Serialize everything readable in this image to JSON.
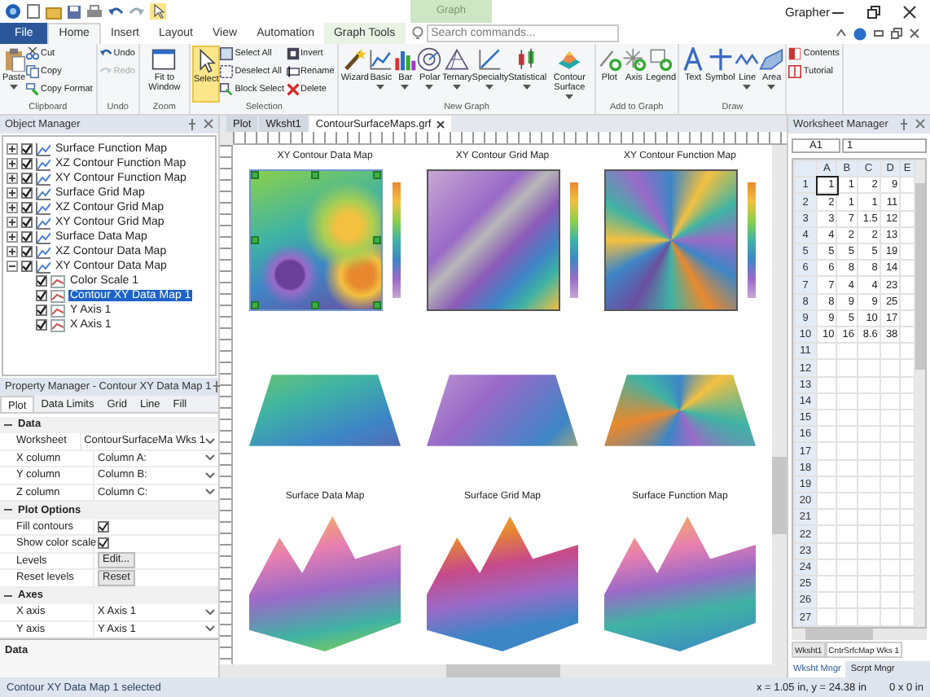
{
  "window": {
    "title": "Grapher",
    "contextual_header": "Graph"
  },
  "ribbon_tabs": [
    {
      "label": "File",
      "kind": "file",
      "selected": false
    },
    {
      "label": "Home",
      "kind": "tab",
      "selected": true
    },
    {
      "label": "Insert",
      "kind": "tab",
      "selected": false
    },
    {
      "label": "Layout",
      "kind": "tab",
      "selected": false
    },
    {
      "label": "View",
      "kind": "tab",
      "selected": false
    },
    {
      "label": "Automation",
      "kind": "tab",
      "selected": false
    },
    {
      "label": "Graph Tools",
      "kind": "contextual",
      "selected": false
    }
  ],
  "search": {
    "placeholder": "Search commands..."
  },
  "ribbon_groups": [
    {
      "label": "Clipboard",
      "buttons": [
        {
          "label": "Paste",
          "kind": "large",
          "dropdown": true,
          "disabled": false,
          "on": false
        },
        {
          "label": "Cut",
          "kind": "small",
          "dropdown": false,
          "disabled": false,
          "on": false
        },
        {
          "label": "Copy",
          "kind": "small",
          "dropdown": false,
          "disabled": false,
          "on": false
        },
        {
          "label": "Copy Format",
          "kind": "small",
          "dropdown": false,
          "disabled": false,
          "on": false
        }
      ]
    },
    {
      "label": "Undo",
      "buttons": [
        {
          "label": "Undo",
          "kind": "small",
          "dropdown": false,
          "disabled": false,
          "on": false
        },
        {
          "label": "Redo",
          "kind": "small",
          "dropdown": false,
          "disabled": true,
          "on": false
        }
      ]
    },
    {
      "label": "Zoom",
      "buttons": [
        {
          "label": "Fit to Window",
          "kind": "large",
          "dropdown": false,
          "disabled": false,
          "on": false
        }
      ]
    },
    {
      "label": "Selection",
      "buttons": [
        {
          "label": "Select",
          "kind": "large",
          "dropdown": false,
          "disabled": false,
          "on": true
        },
        {
          "label": "Select All",
          "kind": "small",
          "dropdown": false,
          "disabled": false,
          "on": false
        },
        {
          "label": "Deselect All",
          "kind": "small",
          "dropdown": false,
          "disabled": false,
          "on": false
        },
        {
          "label": "Block Select",
          "kind": "small",
          "dropdown": false,
          "disabled": false,
          "on": false
        },
        {
          "label": "Invert",
          "kind": "small",
          "dropdown": false,
          "disabled": false,
          "on": false
        },
        {
          "label": "Rename",
          "kind": "small",
          "dropdown": false,
          "disabled": false,
          "on": false
        },
        {
          "label": "Delete",
          "kind": "small",
          "dropdown": false,
          "disabled": false,
          "on": false
        }
      ]
    },
    {
      "label": "New Graph",
      "buttons": [
        {
          "label": "Wizard",
          "kind": "large",
          "dropdown": false,
          "disabled": false,
          "on": false
        },
        {
          "label": "Basic",
          "kind": "large",
          "dropdown": true,
          "disabled": false,
          "on": false
        },
        {
          "label": "Bar",
          "kind": "large",
          "dropdown": true,
          "disabled": false,
          "on": false
        },
        {
          "label": "Polar",
          "kind": "large",
          "dropdown": true,
          "disabled": false,
          "on": false
        },
        {
          "label": "Ternary",
          "kind": "large",
          "dropdown": true,
          "disabled": false,
          "on": false
        },
        {
          "label": "Specialty",
          "kind": "large",
          "dropdown": true,
          "disabled": false,
          "on": false
        },
        {
          "label": "Statistical",
          "kind": "large",
          "dropdown": true,
          "disabled": false,
          "on": false
        },
        {
          "label": "Contour Surface",
          "kind": "large",
          "dropdown": true,
          "disabled": false,
          "on": false
        }
      ]
    },
    {
      "label": "Add to Graph",
      "buttons": [
        {
          "label": "Plot",
          "kind": "large",
          "dropdown": false,
          "disabled": false,
          "on": false
        },
        {
          "label": "Axis",
          "kind": "large",
          "dropdown": false,
          "disabled": false,
          "on": false
        },
        {
          "label": "Legend",
          "kind": "large",
          "dropdown": false,
          "disabled": false,
          "on": false
        }
      ]
    },
    {
      "label": "Draw",
      "buttons": [
        {
          "label": "Text",
          "kind": "large",
          "dropdown": false,
          "disabled": false,
          "on": false
        },
        {
          "label": "Symbol",
          "kind": "large",
          "dropdown": false,
          "disabled": false,
          "on": false
        },
        {
          "label": "Line",
          "kind": "large",
          "dropdown": true,
          "disabled": false,
          "on": false
        },
        {
          "label": "Area",
          "kind": "large",
          "dropdown": true,
          "disabled": false,
          "on": false
        }
      ]
    },
    {
      "buttons": [
        {
          "label": "Contents",
          "kind": "small",
          "dropdown": false,
          "disabled": false,
          "on": false
        },
        {
          "label": "Tutorial",
          "kind": "small",
          "dropdown": false,
          "disabled": false,
          "on": false
        }
      ]
    }
  ],
  "object_manager": {
    "title": "Object Manager",
    "items": [
      {
        "label": "Surface Function Map",
        "checked": true,
        "expanded": false,
        "selected": false
      },
      {
        "label": "XZ Contour Function Map",
        "checked": true,
        "expanded": false,
        "selected": false
      },
      {
        "label": "XY Contour Function Map",
        "checked": true,
        "expanded": false,
        "selected": false
      },
      {
        "label": "Surface Grid Map",
        "checked": true,
        "expanded": false,
        "selected": false
      },
      {
        "label": "XZ Contour Grid Map",
        "checked": true,
        "expanded": false,
        "selected": false
      },
      {
        "label": "XY Contour Grid Map",
        "checked": true,
        "expanded": false,
        "selected": false
      },
      {
        "label": "Surface Data Map",
        "checked": true,
        "expanded": false,
        "selected": false
      },
      {
        "label": "XZ Contour Data Map",
        "checked": true,
        "expanded": false,
        "selected": false
      },
      {
        "label": "XY Contour Data Map",
        "checked": true,
        "expanded": true,
        "selected": false,
        "children": [
          {
            "label": "Color Scale 1",
            "checked": true,
            "selected": false
          },
          {
            "label": "Contour XY Data Map 1",
            "checked": true,
            "selected": true
          },
          {
            "label": "Y Axis 1",
            "checked": true,
            "selected": false
          },
          {
            "label": "X Axis 1",
            "checked": true,
            "selected": false
          }
        ]
      }
    ]
  },
  "property_manager": {
    "title": "Property Manager - Contour XY Data Map 1",
    "tabs": [
      {
        "label": "Plot",
        "selected": true
      },
      {
        "label": "Data Limits",
        "selected": false
      },
      {
        "label": "Grid",
        "selected": false
      },
      {
        "label": "Line",
        "selected": false
      },
      {
        "label": "Fill",
        "selected": false
      }
    ],
    "sections": [
      {
        "label": "Data",
        "expanded": true,
        "rows": [
          {
            "label": "Worksheet",
            "kind": "dropdown",
            "value": "ContourSurfaceMa Wks 1"
          },
          {
            "label": "X column",
            "kind": "dropdown",
            "value": "Column A:"
          },
          {
            "label": "Y column",
            "kind": "dropdown",
            "value": "Column B:"
          },
          {
            "label": "Z column",
            "kind": "dropdown",
            "value": "Column C:"
          }
        ]
      },
      {
        "label": "Plot Options",
        "expanded": true,
        "rows": [
          {
            "label": "Fill contours",
            "kind": "checkbox",
            "checked": true
          },
          {
            "label": "Show color scale",
            "kind": "checkbox",
            "checked": true
          },
          {
            "label": "Levels",
            "kind": "button",
            "value": "Edit..."
          },
          {
            "label": "Reset levels",
            "kind": "button",
            "value": "Reset"
          }
        ]
      },
      {
        "label": "Axes",
        "expanded": true,
        "rows": [
          {
            "label": "X axis",
            "kind": "dropdown",
            "value": "X Axis 1"
          },
          {
            "label": "Y axis",
            "kind": "dropdown",
            "value": "Y Axis 1"
          }
        ]
      }
    ],
    "description": "Data"
  },
  "document_tabs": [
    {
      "label": "Plot",
      "selected": false,
      "closable": false
    },
    {
      "label": "Wksht1",
      "selected": false,
      "closable": false
    },
    {
      "label": "ContourSurfaceMaps.grf",
      "selected": true,
      "closable": true
    }
  ],
  "graphs": [
    {
      "title": "XY Contour Data Map",
      "kind": "contour-data",
      "color_scale": true,
      "selected": true
    },
    {
      "title": "XY Contour Grid Map",
      "kind": "contour-grid",
      "color_scale": true,
      "selected": false
    },
    {
      "title": "XY Contour Function Map",
      "kind": "contour-function",
      "color_scale": true,
      "selected": false
    },
    {
      "kind": "xz-data",
      "color_scale": false,
      "selected": false
    },
    {
      "kind": "xz-grid",
      "color_scale": false,
      "selected": false
    },
    {
      "kind": "xz-function",
      "color_scale": false,
      "selected": false
    },
    {
      "title": "Surface Data Map",
      "kind": "surface-data",
      "color_scale": false,
      "selected": false
    },
    {
      "title": "Surface Grid Map",
      "kind": "surface-grid",
      "color_scale": false,
      "selected": false
    },
    {
      "title": "Surface Function Map",
      "kind": "surface-function",
      "color_scale": false,
      "selected": false
    }
  ],
  "worksheet_manager": {
    "title": "Worksheet Manager",
    "cell_name": "A1",
    "cell_value": "1",
    "columns": [
      "A",
      "B",
      "C",
      "D",
      "E"
    ],
    "rows": [
      {
        "header": "1",
        "cells": [
          "1",
          "1",
          "2",
          "9"
        ]
      },
      {
        "header": "2",
        "cells": [
          "2",
          "1",
          "1",
          "11"
        ]
      },
      {
        "header": "3",
        "cells": [
          "3",
          "7",
          "1.5",
          "12"
        ]
      },
      {
        "header": "4",
        "cells": [
          "4",
          "2",
          "2",
          "13"
        ]
      },
      {
        "header": "5",
        "cells": [
          "5",
          "5",
          "5",
          "19"
        ]
      },
      {
        "header": "6",
        "cells": [
          "6",
          "8",
          "8",
          "14"
        ]
      },
      {
        "header": "7",
        "cells": [
          "7",
          "4",
          "4",
          "23"
        ]
      },
      {
        "header": "8",
        "cells": [
          "8",
          "9",
          "9",
          "25"
        ]
      },
      {
        "header": "9",
        "cells": [
          "9",
          "5",
          "10",
          "17"
        ]
      },
      {
        "header": "10",
        "cells": [
          "10",
          "16",
          "8.6",
          "38"
        ]
      },
      {
        "header": "11"
      },
      {
        "header": "12"
      },
      {
        "header": "13"
      },
      {
        "header": "14"
      },
      {
        "header": "15"
      },
      {
        "header": "16"
      },
      {
        "header": "17"
      },
      {
        "header": "18"
      },
      {
        "header": "19"
      },
      {
        "header": "20"
      },
      {
        "header": "21"
      },
      {
        "header": "22"
      },
      {
        "header": "23"
      },
      {
        "header": "24"
      },
      {
        "header": "25"
      },
      {
        "header": "26"
      },
      {
        "header": "27"
      }
    ],
    "sheet_tabs": [
      {
        "label": "Wksht1",
        "selected": false
      },
      {
        "label": "CntrSrfcMap Wks 1",
        "selected": true
      }
    ]
  },
  "panel_tabs": [
    {
      "label": "Wksht Mngr",
      "selected": true
    },
    {
      "label": "Scrpt Mngr",
      "selected": false
    }
  ],
  "status_bar": {
    "message": "Contour XY Data Map 1 selected",
    "position": "x = 1.05 in, y = 24.38 in",
    "size": "0 x 0 in"
  }
}
